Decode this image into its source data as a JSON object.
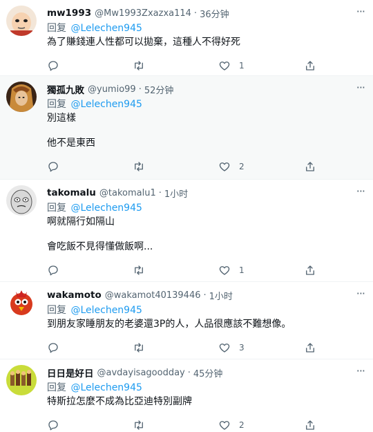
{
  "reply_prefix": "回复",
  "tweets": [
    {
      "username": "mw1993",
      "handle": "@Mw1993Zxazxa114",
      "time": "36分钟",
      "reply_to": "@Lelechen945",
      "lines": [
        "為了賺錢連人性都可以拋棄，這種人不得好死"
      ],
      "likes": "1"
    },
    {
      "username": "獨孤九敗",
      "handle": "@yumio99",
      "time": "52分钟",
      "reply_to": "@Lelechen945",
      "lines": [
        "別這樣",
        "他不是東西"
      ],
      "likes": "2"
    },
    {
      "username": "takomalu",
      "handle": "@takomalu1",
      "time": "1小时",
      "reply_to": "@Lelechen945",
      "lines": [
        "啊就隔行如隔山",
        "會吃飯不見得懂做飯啊..."
      ],
      "likes": "1"
    },
    {
      "username": "wakamoto",
      "handle": "@wakamot40139446",
      "time": "1小时",
      "reply_to": "@Lelechen945",
      "lines": [
        "到朋友家睡朋友的老婆還3P的人，人品很應該不難想像。"
      ],
      "likes": "3"
    },
    {
      "username": "日日是好日",
      "handle": "@avdayisagoodday",
      "time": "45分钟",
      "reply_to": "@Lelechen945",
      "lines": [
        "特斯拉怎麼不成為比亞迪特別副牌"
      ],
      "likes": "2"
    }
  ],
  "icons": {
    "reply": "reply-icon",
    "retweet": "retweet-icon",
    "like": "heart-icon",
    "share": "share-icon",
    "more": "more-icon"
  },
  "colors": {
    "mention": "#1d9bf0",
    "muted": "#536471",
    "alt_row_bg": "#f7f9f9"
  }
}
